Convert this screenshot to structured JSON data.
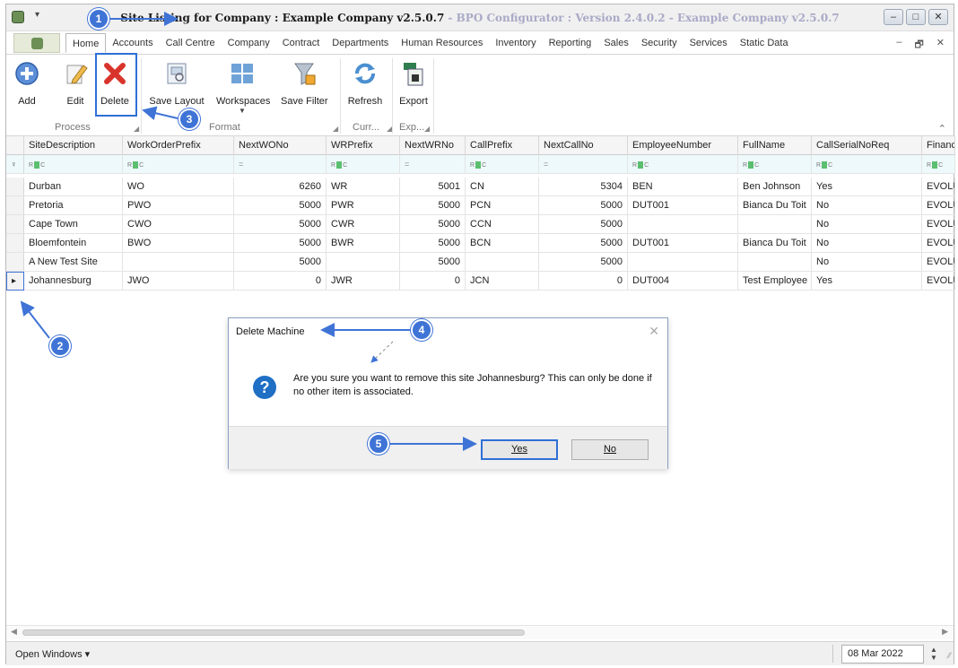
{
  "window": {
    "title_main": "Site Listing for Company : Example Company v2.5.0.7",
    "title_sub": " - BPO Configurator : Version 2.4.0.2 - Example Company v2.5.0.7",
    "controls": [
      "–",
      "□",
      "✕"
    ]
  },
  "menu": {
    "tabs": [
      "Home",
      "Accounts",
      "Call Centre",
      "Company",
      "Contract",
      "Departments",
      "Human Resources",
      "Inventory",
      "Reporting",
      "Sales",
      "Security",
      "Services",
      "Static Data"
    ],
    "active_tab": "Home",
    "controls": [
      "–",
      "🗗",
      "✕"
    ]
  },
  "ribbon": {
    "add": "Add",
    "edit": "Edit",
    "delete": "Delete",
    "save_layout": "Save Layout",
    "workspaces": "Workspaces",
    "save_filter": "Save Filter",
    "refresh": "Refresh",
    "export": "Export",
    "groups": {
      "process": "Process",
      "format": "Format",
      "current": "Curr...",
      "export": "Exp..."
    },
    "collapse": "⌃"
  },
  "grid": {
    "columns": [
      "SiteDescription",
      "WorkOrderPrefix",
      "NextWONo",
      "WRPrefix",
      "NextWRNo",
      "CallPrefix",
      "NextCallNo",
      "EmployeeNumber",
      "FullName",
      "CallSerialNoReq",
      "Financi"
    ],
    "filter_text": {
      "abc_left": "R",
      "abc_right": "C",
      "eq": "="
    },
    "rows": [
      [
        "Durban",
        "WO",
        "6260",
        "WR",
        "5001",
        "CN",
        "5304",
        "BEN",
        "Ben Johnson",
        "Yes",
        "EVOLU"
      ],
      [
        "Pretoria",
        "PWO",
        "5000",
        "PWR",
        "5000",
        "PCN",
        "5000",
        "DUT001",
        "Bianca Du Toit",
        "No",
        "EVOLU"
      ],
      [
        "Cape Town",
        "CWO",
        "5000",
        "CWR",
        "5000",
        "CCN",
        "5000",
        "",
        "",
        "No",
        "EVOLU"
      ],
      [
        "Bloemfontein",
        "BWO",
        "5000",
        "BWR",
        "5000",
        "BCN",
        "5000",
        "DUT001",
        "Bianca Du Toit",
        "No",
        "EVOLU"
      ],
      [
        "A New Test Site",
        "",
        "5000",
        "",
        "5000",
        "",
        "5000",
        "",
        "",
        "No",
        "EVOLU"
      ],
      [
        "Johannesburg",
        "JWO",
        "0",
        "JWR",
        "0",
        "JCN",
        "0",
        "DUT004",
        "Test Employee",
        "Yes",
        "EVOLU"
      ]
    ],
    "selected_row_marker": "▸",
    "filter_row_marker": "♀"
  },
  "dialog": {
    "title": "Delete Machine",
    "close": "✕",
    "icon": "?",
    "message": "Are you sure you want to remove this site Johannesburg? This can only be done if no other item is associated.",
    "yes": "Yes",
    "no": "No"
  },
  "statusbar": {
    "open_windows": "Open Windows ▾",
    "date": "08 Mar 2022"
  },
  "annotations": [
    "1",
    "2",
    "3",
    "4",
    "5"
  ],
  "colors": {
    "accent": "#3f74d6",
    "delete_red": "#d9342b",
    "question_blue": "#1f6fc5"
  }
}
